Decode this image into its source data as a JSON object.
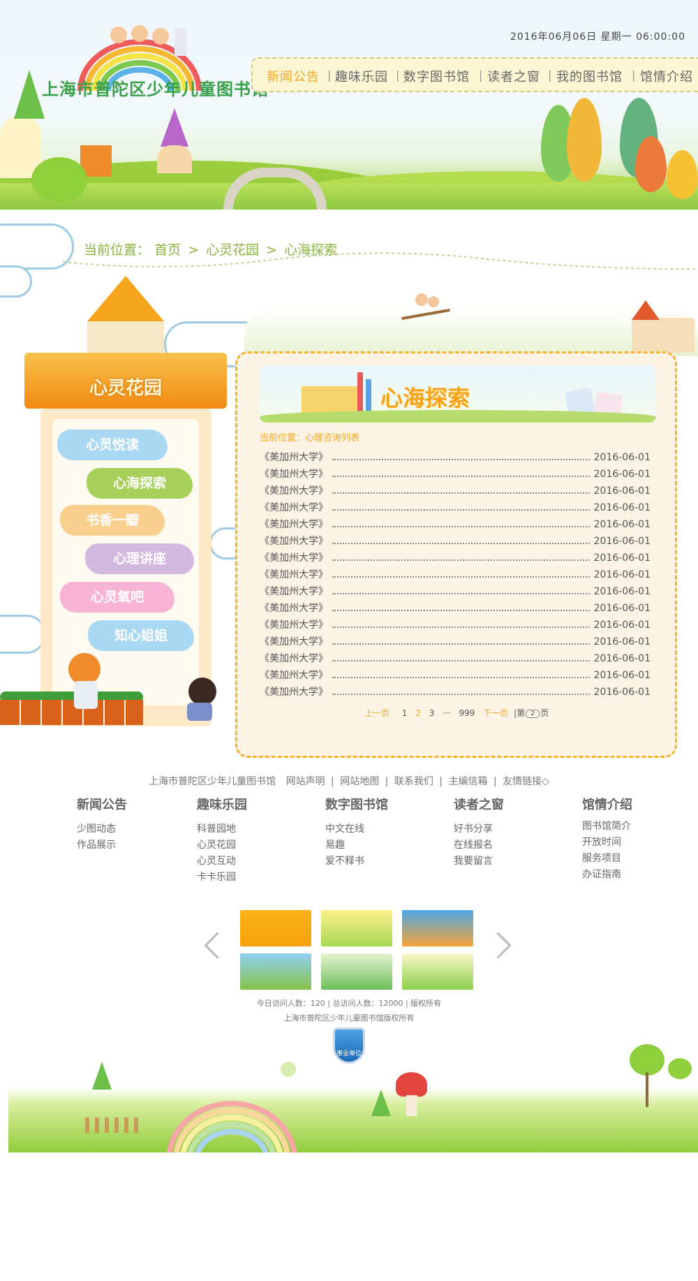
{
  "header": {
    "site_title": "上海市普陀区少年儿童图书馆",
    "datetime": "2016年06月06日 星期一 06:00:00",
    "nav": [
      "新闻公告",
      "趣味乐园",
      "数字图书馆",
      "读者之窗",
      "我的图书馆",
      "馆情介绍"
    ],
    "active_nav": "新闻公告"
  },
  "breadcrumb": {
    "prefix": "当前位置：",
    "items": [
      "首页",
      "心灵花园",
      "心海探索"
    ],
    "sep": ">"
  },
  "sidebar": {
    "title": "心灵花园",
    "items": [
      {
        "label": "心灵悦读",
        "color": "#a9d8f2"
      },
      {
        "label": "心海探索",
        "color": "#a6d05a"
      },
      {
        "label": "书香一瓣",
        "color": "#f9cf8e"
      },
      {
        "label": "心理讲座",
        "color": "#d3b8e0"
      },
      {
        "label": "心灵氧吧",
        "color": "#f7b4d4"
      },
      {
        "label": "知心姐姐",
        "color": "#a9d8f2"
      }
    ]
  },
  "main": {
    "banner_title": "心海探索",
    "inner_breadcrumb": "当前位置：心理咨询列表",
    "list": [
      {
        "title": "《美加州大学》",
        "date": "2016-06-01"
      },
      {
        "title": "《美加州大学》",
        "date": "2016-06-01"
      },
      {
        "title": "《美加州大学》",
        "date": "2016-06-01"
      },
      {
        "title": "《美加州大学》",
        "date": "2016-06-01"
      },
      {
        "title": "《美加州大学》",
        "date": "2016-06-01"
      },
      {
        "title": "《美加州大学》",
        "date": "2016-06-01"
      },
      {
        "title": "《美加州大学》",
        "date": "2016-06-01"
      },
      {
        "title": "《美加州大学》",
        "date": "2016-06-01"
      },
      {
        "title": "《美加州大学》",
        "date": "2016-06-01"
      },
      {
        "title": "《美加州大学》",
        "date": "2016-06-01"
      },
      {
        "title": "《美加州大学》",
        "date": "2016-06-01"
      },
      {
        "title": "《美加州大学》",
        "date": "2016-06-01"
      },
      {
        "title": "《美加州大学》",
        "date": "2016-06-01"
      },
      {
        "title": "《美加州大学》",
        "date": "2016-06-01"
      },
      {
        "title": "《美加州大学》",
        "date": "2016-06-01"
      }
    ],
    "pager": {
      "prev": "上一页",
      "pages": [
        "1",
        "2",
        "3",
        "···",
        "999"
      ],
      "current": "2",
      "next": "下一页",
      "jump_prefix": "第",
      "jump_value": "2",
      "jump_suffix": "页"
    }
  },
  "footer": {
    "links": [
      "上海市普陀区少年儿童图书馆",
      "网站声明",
      "网站地图",
      "联系我们",
      "主编信箱",
      "友情链接◇"
    ],
    "columns": [
      {
        "title": "新闻公告",
        "items": [
          "少图动态",
          "作品展示"
        ]
      },
      {
        "title": "趣味乐园",
        "items": [
          "科普园地",
          "心灵花园",
          "心灵互动",
          "卡卡乐园"
        ]
      },
      {
        "title": "数字图书馆",
        "items": [
          "中文在线",
          "易趣",
          "爱不释书"
        ]
      },
      {
        "title": "读者之窗",
        "items": [
          "好书分享",
          "在线报名",
          "我要留言"
        ]
      },
      {
        "title": "馆情介绍",
        "items": [
          "图书馆简介",
          "开放时间",
          "服务项目",
          "办证指南"
        ]
      }
    ],
    "stats": "今日访问人数：120 | 总访问人数：12000 | 版权所有",
    "copyright": "上海市普陀区少年儿童图书馆版权所有",
    "badge": "事业单位"
  }
}
